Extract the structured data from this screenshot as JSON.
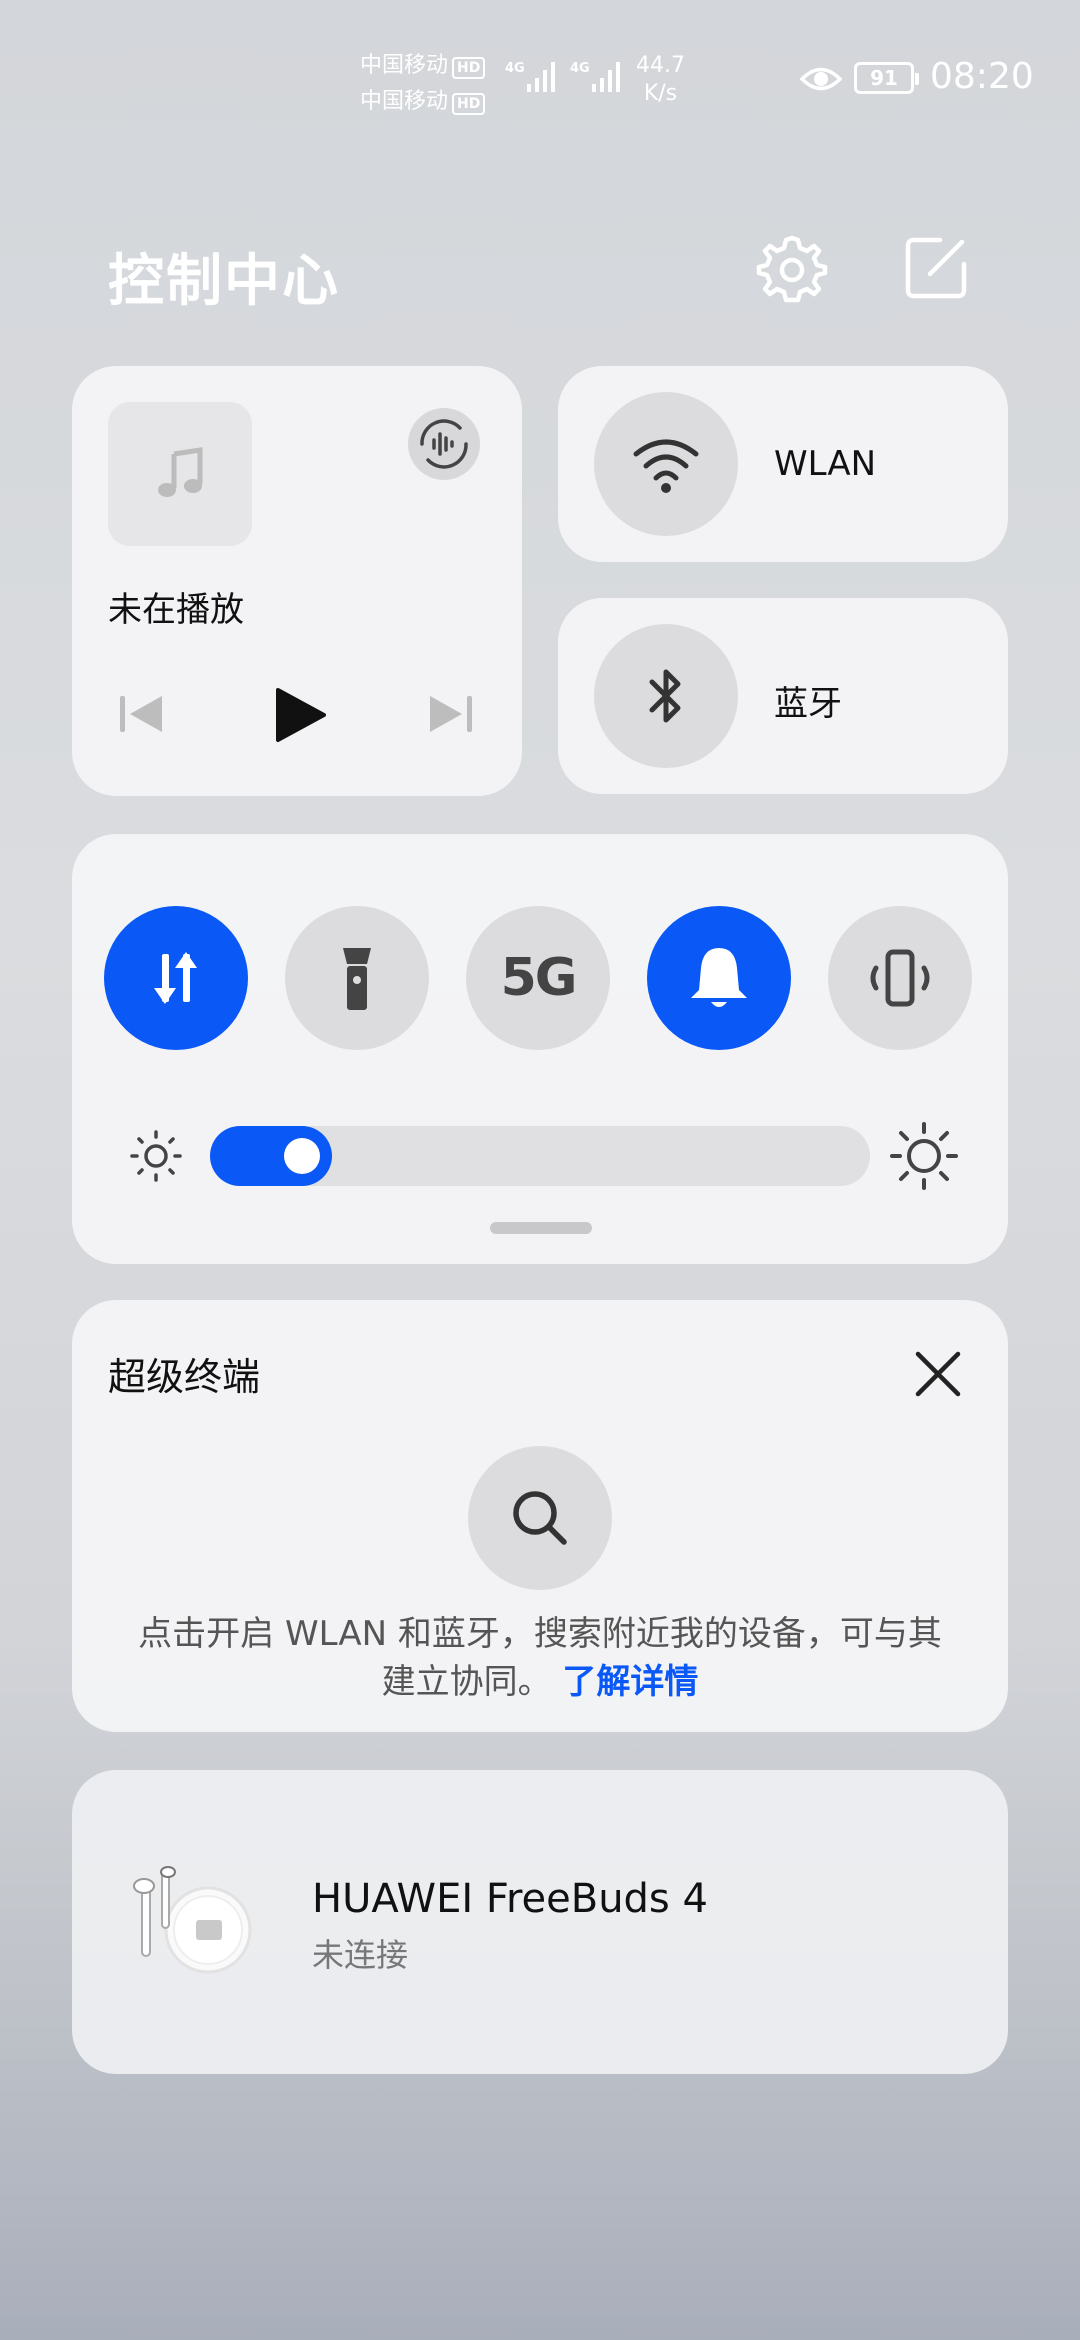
{
  "status_bar": {
    "carrier1": "中国移动",
    "carrier2": "中国移动",
    "hd_label": "HD",
    "net_type": "4G",
    "speed_value": "44.7",
    "speed_unit": "K/s",
    "battery": "91",
    "time": "08:20"
  },
  "header": {
    "title": "控制中心",
    "settings_icon": "gear-icon",
    "edit_icon": "edit-icon"
  },
  "media": {
    "status": "未在播放",
    "icons": [
      "music-note-icon",
      "audio-share-icon",
      "previous-icon",
      "play-icon",
      "next-icon"
    ]
  },
  "wlan": {
    "label": "WLAN",
    "icon": "wifi-icon"
  },
  "bluetooth": {
    "label": "蓝牙",
    "icon": "bluetooth-icon"
  },
  "toggles": [
    {
      "name": "mobile-data",
      "icon": "data-transfer-icon",
      "on": true
    },
    {
      "name": "flashlight",
      "icon": "flashlight-icon",
      "on": false
    },
    {
      "name": "5g",
      "label": "5G",
      "on": false
    },
    {
      "name": "sound",
      "icon": "bell-icon",
      "on": true
    },
    {
      "name": "vibrate",
      "icon": "vibrate-icon",
      "on": false
    }
  ],
  "brightness": {
    "level": 0.14
  },
  "super_device": {
    "title": "超级终端",
    "hint_text": "点击开启 WLAN 和蓝牙，搜索附近我的设备，可与其建立协同。",
    "link_text": "了解详情"
  },
  "device": {
    "name": "HUAWEI FreeBuds 4",
    "status": "未连接"
  },
  "colors": {
    "accent": "#0a59f7",
    "card": "#f5f5f7"
  }
}
